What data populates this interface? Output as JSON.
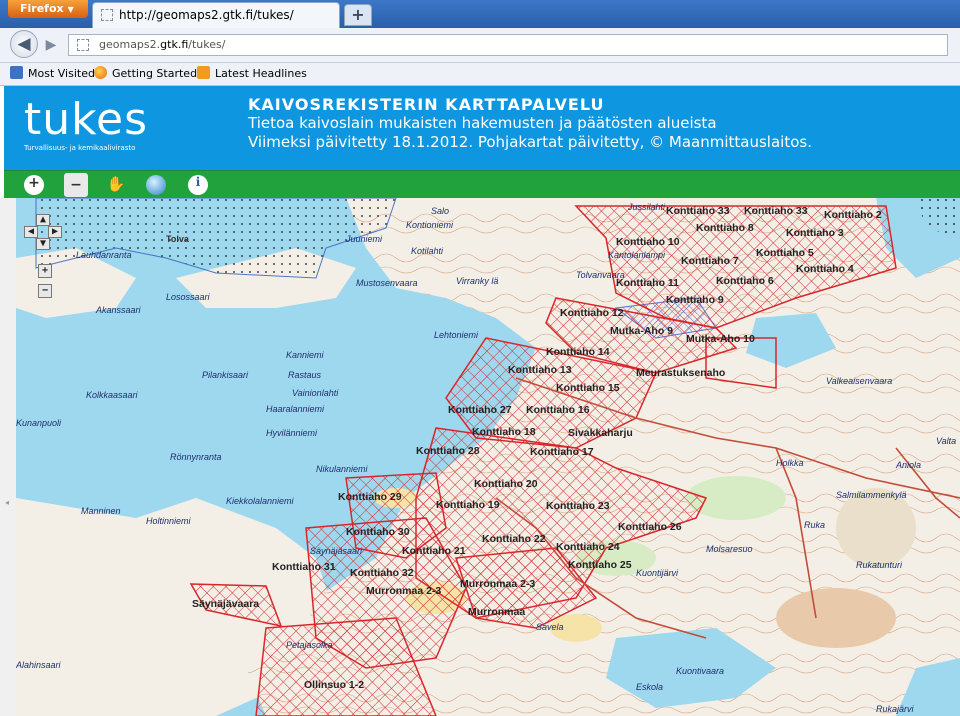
{
  "browser": {
    "menu_button": "Firefox",
    "tab_title": "http://geomaps2.gtk.fi/tukes/",
    "new_tab_label": "+",
    "url_prefix": "geomaps2.",
    "url_domain": "gtk.fi",
    "url_path": "/tukes/",
    "bookmarks": [
      "Most Visited",
      "Getting Started",
      "Latest Headlines"
    ]
  },
  "header": {
    "logo_word": "tukes",
    "logo_subtitle": "Turvallisuus- ja kemikaalivirasto",
    "title": "KAIVOSREKISTERIN KARTTAPALVELU",
    "line1": "Tietoa kaivoslain mukaisten hakemusten ja päätösten alueista",
    "line2": "Viimeksi päivitetty 18.1.2012. Pohjakartat päivitetty, © Maanmittauslaitos.",
    "background_color": "#0f96e0"
  },
  "toolbar": {
    "background_color": "#22a23c",
    "tools": [
      {
        "name": "zoom-in-icon",
        "glyph": "+"
      },
      {
        "name": "zoom-out-icon",
        "glyph": "−"
      },
      {
        "name": "pan-hand-icon",
        "glyph": "✋"
      },
      {
        "name": "globe-icon",
        "glyph": "◍"
      },
      {
        "name": "info-icon",
        "glyph": "i"
      }
    ]
  },
  "map": {
    "area_color": "#d9262b",
    "water_color": "#9ed8ef",
    "areas": [
      "Konttiaho 33",
      "Konttiaho 33",
      "Konttiaho 2",
      "Konttiaho 8",
      "Konttiaho 3",
      "Konttiaho 10",
      "Konttiaho 7",
      "Konttiaho 5",
      "Konttiaho 4",
      "Konttiaho 11",
      "Konttiaho 6",
      "Konttiaho 9",
      "Konttiaho 12",
      "Mutka-Aho 9",
      "Mutka-Aho 10",
      "Konttiaho 14",
      "Konttiaho 13",
      "Meurastuksenaho",
      "Konttiaho 15",
      "Konttiaho 27",
      "Konttiaho 16",
      "Konttiaho 18",
      "Sivakkaharju",
      "Konttiaho 28",
      "Konttiaho 17",
      "Konttiaho 20",
      "Konttiaho 29",
      "Konttiaho 19",
      "Konttiaho 23",
      "Konttiaho 26",
      "Konttiaho 30",
      "Konttiaho 22",
      "Konttiaho 24",
      "Konttiaho 21",
      "Konttiaho 25",
      "Konttiaho 31",
      "Konttiaho 32",
      "Murronmaa 2-3",
      "Murronmaa 2-3",
      "Murronmaa",
      "Säynäjävaara",
      "Ollinsuo 1-2"
    ],
    "places": [
      "Tolva",
      "Salo",
      "Kontioniemi",
      "Juuniemi",
      "Kotilahti",
      "Lauhdanranta",
      "Mustosenvaara",
      "Virranky lä",
      "Losossaari",
      "Akanssaari",
      "Lehtoniemi",
      "Kanniemi",
      "Pilankisaari",
      "Rastaus",
      "Kolkkaasaari",
      "Vainionlahti",
      "Rönnynranta",
      "Hyvilänniemi",
      "Nikulanniemi",
      "Manninen",
      "Holtinniemi",
      "Kiekkolalanniemi",
      "Säynäjäsaari",
      "Petajasolka",
      "Alahinsaari",
      "Ruka",
      "Rukatunturi",
      "Salmilammenkylä",
      "Valkeaisenvaara",
      "Kuontivaara",
      "Eskola",
      "Savela",
      "Kuontijärvi",
      "Molsaresuo",
      "Rukajärvi",
      "Holkka",
      "Aniola",
      "Valta",
      "Kantolanlampi",
      "Tolvanvaara",
      "Haaralanniemi",
      "Jussilahti",
      "Kunanpuoli"
    ]
  }
}
